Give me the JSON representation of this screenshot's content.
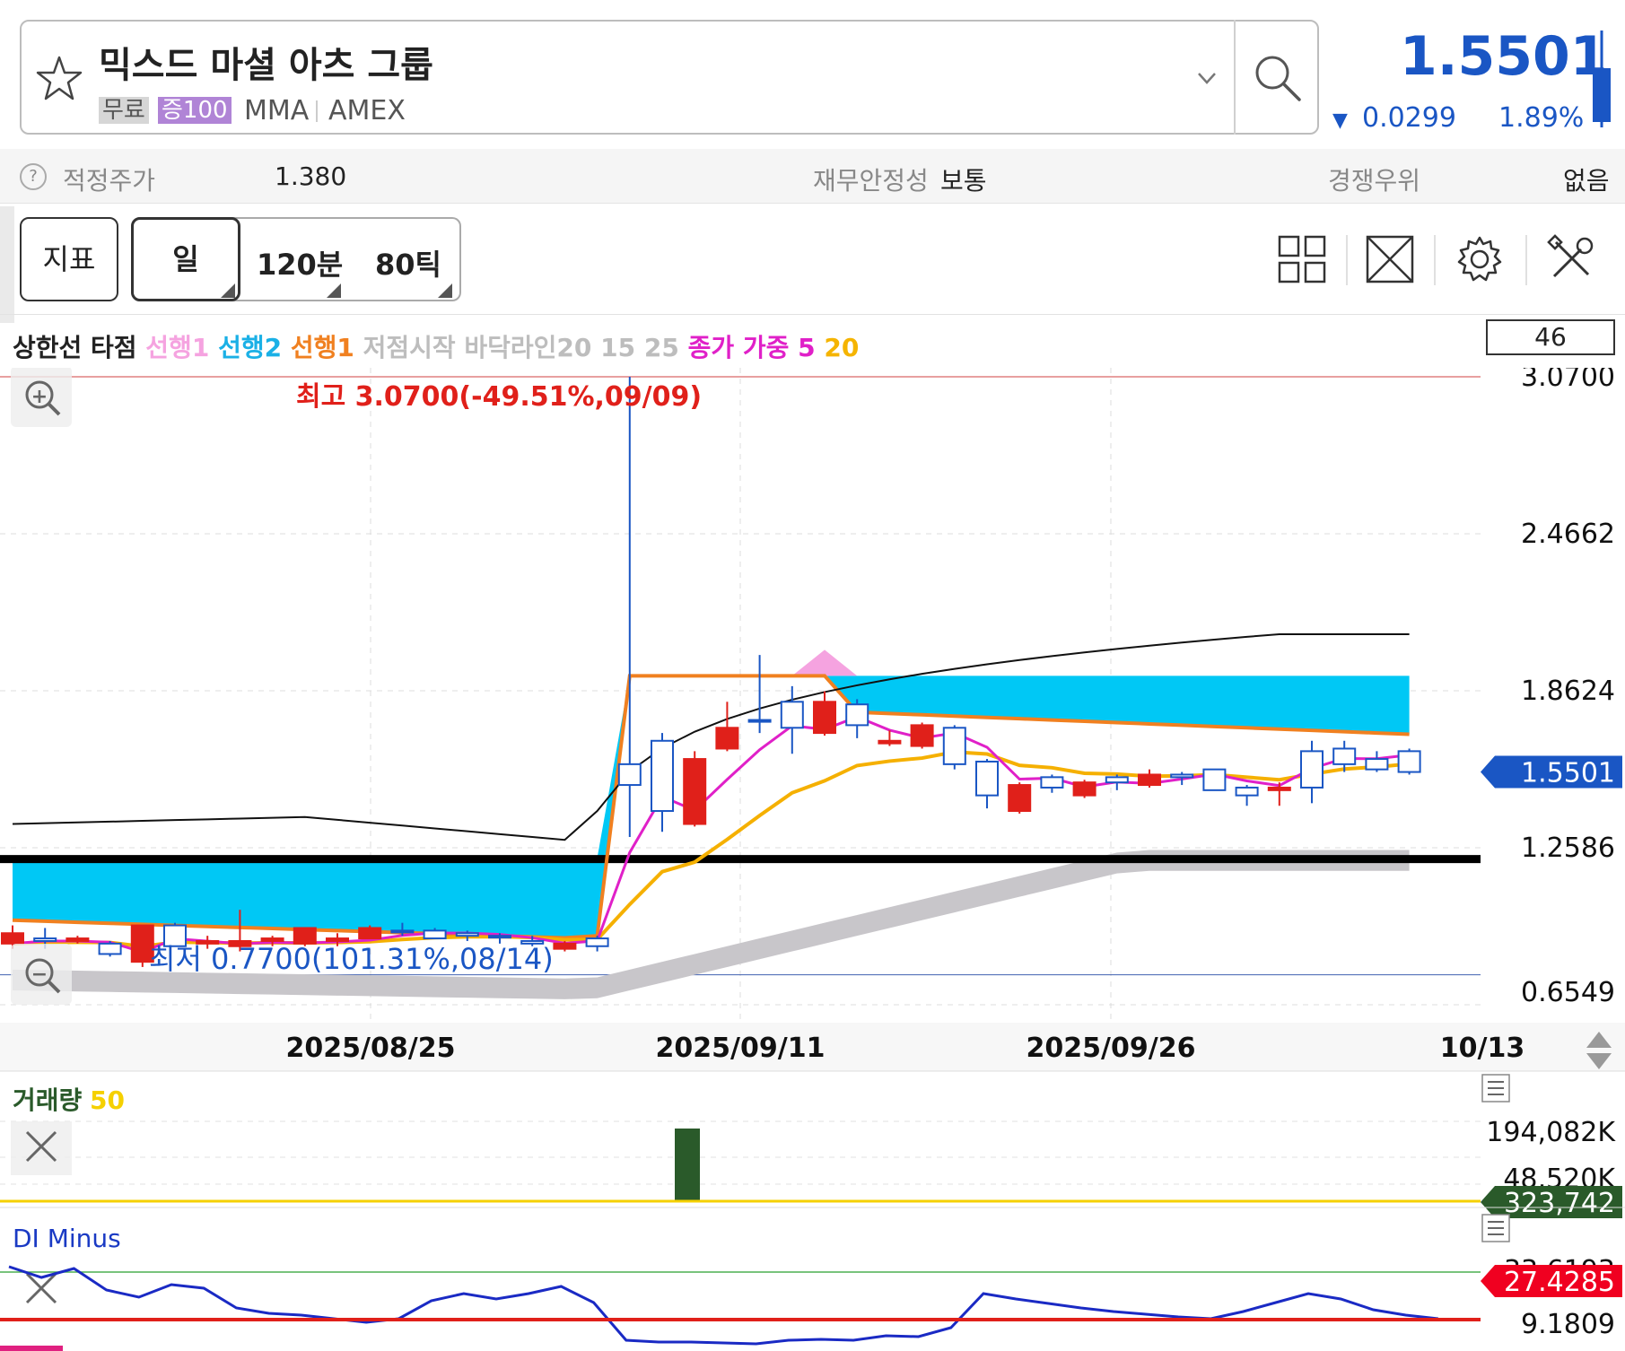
{
  "header": {
    "stock_name": "믹스드 마셜 아츠 그룹",
    "tag_free": "무료",
    "tag_margin": "증100",
    "ticker": "MMA",
    "exchange": "AMEX",
    "price": "1.5501",
    "change_arrow": "▼",
    "change": "0.0299",
    "change_pct": "1.89%",
    "price_color": "#1a56c4"
  },
  "info_bar": {
    "help": "?",
    "fair_price_label": "적정주가",
    "fair_price_value": "1.380",
    "stability_label": "재무안정성",
    "stability_value": "보통",
    "competitive_label": "경쟁우위",
    "competitive_value": "없음"
  },
  "toolbar": {
    "indicator_label": "지표",
    "day_label": "일",
    "min120_label": "120분",
    "tick80_label": "80틱"
  },
  "legend": {
    "items": [
      {
        "text": "상한선 타점 ",
        "color": "#222222"
      },
      {
        "text": "선행1 ",
        "color": "#f5a3e0"
      },
      {
        "text": "선행2 ",
        "color": "#1ab0e6"
      },
      {
        "text": "선행1 ",
        "color": "#f08020"
      },
      {
        "text": "저점시작 바닥라인20 15 25 ",
        "color": "#bdbdbd"
      },
      {
        "text": "종가 가중 5 ",
        "color": "#e020c8"
      },
      {
        "text": "20",
        "color": "#f5b400"
      }
    ],
    "count": "46"
  },
  "chart_data": {
    "type": "candlestick",
    "price_axis": {
      "ticks": [
        "3.0700",
        "2.4662",
        "1.8624",
        "1.2586",
        "0.6549"
      ],
      "min": 0.6549,
      "max": 3.07,
      "current": "1.5501"
    },
    "date_axis": {
      "ticks": [
        "2025/08/25",
        "2025/09/11",
        "2025/09/26",
        "10/13"
      ]
    },
    "high_annotation": "최고 3.0700(-49.51%,09/09)",
    "low_annotation": "최저 0.7700(101.31%,08/14)",
    "candles": [
      {
        "o": 0.93,
        "h": 0.96,
        "l": 0.87,
        "c": 0.89
      },
      {
        "o": 0.9,
        "h": 0.95,
        "l": 0.87,
        "c": 0.91
      },
      {
        "o": 0.91,
        "h": 0.92,
        "l": 0.89,
        "c": 0.9
      },
      {
        "o": 0.85,
        "h": 0.9,
        "l": 0.84,
        "c": 0.89
      },
      {
        "o": 0.96,
        "h": 0.96,
        "l": 0.8,
        "c": 0.82
      },
      {
        "o": 0.88,
        "h": 0.97,
        "l": 0.88,
        "c": 0.96
      },
      {
        "o": 0.9,
        "h": 0.92,
        "l": 0.87,
        "c": 0.89
      },
      {
        "o": 0.9,
        "h": 1.02,
        "l": 0.86,
        "c": 0.88
      },
      {
        "o": 0.91,
        "h": 0.92,
        "l": 0.88,
        "c": 0.9
      },
      {
        "o": 0.95,
        "h": 0.95,
        "l": 0.88,
        "c": 0.89
      },
      {
        "o": 0.91,
        "h": 0.93,
        "l": 0.88,
        "c": 0.9
      },
      {
        "o": 0.95,
        "h": 0.96,
        "l": 0.91,
        "c": 0.91
      },
      {
        "o": 0.94,
        "h": 0.97,
        "l": 0.92,
        "c": 0.94
      },
      {
        "o": 0.91,
        "h": 0.95,
        "l": 0.91,
        "c": 0.94
      },
      {
        "o": 0.92,
        "h": 0.94,
        "l": 0.9,
        "c": 0.93
      },
      {
        "o": 0.92,
        "h": 0.93,
        "l": 0.89,
        "c": 0.92
      },
      {
        "o": 0.89,
        "h": 0.92,
        "l": 0.88,
        "c": 0.9
      },
      {
        "o": 0.89,
        "h": 0.9,
        "l": 0.86,
        "c": 0.87
      },
      {
        "o": 0.88,
        "h": 0.92,
        "l": 0.86,
        "c": 0.91
      },
      {
        "o": 1.5,
        "h": 3.07,
        "l": 1.3,
        "c": 1.58
      },
      {
        "o": 1.4,
        "h": 1.7,
        "l": 1.32,
        "c": 1.67
      },
      {
        "o": 1.6,
        "h": 1.63,
        "l": 1.34,
        "c": 1.35
      },
      {
        "o": 1.72,
        "h": 1.82,
        "l": 1.63,
        "c": 1.64
      },
      {
        "o": 1.75,
        "h": 2.0,
        "l": 1.7,
        "c": 1.75
      },
      {
        "o": 1.72,
        "h": 1.88,
        "l": 1.62,
        "c": 1.82
      },
      {
        "o": 1.82,
        "h": 1.86,
        "l": 1.69,
        "c": 1.7
      },
      {
        "o": 1.73,
        "h": 1.83,
        "l": 1.68,
        "c": 1.81
      },
      {
        "o": 1.67,
        "h": 1.71,
        "l": 1.65,
        "c": 1.66
      },
      {
        "o": 1.73,
        "h": 1.74,
        "l": 1.64,
        "c": 1.65
      },
      {
        "o": 1.58,
        "h": 1.73,
        "l": 1.56,
        "c": 1.72
      },
      {
        "o": 1.46,
        "h": 1.6,
        "l": 1.41,
        "c": 1.59
      },
      {
        "o": 1.5,
        "h": 1.51,
        "l": 1.39,
        "c": 1.4
      },
      {
        "o": 1.49,
        "h": 1.54,
        "l": 1.47,
        "c": 1.53
      },
      {
        "o": 1.51,
        "h": 1.52,
        "l": 1.45,
        "c": 1.46
      },
      {
        "o": 1.51,
        "h": 1.54,
        "l": 1.48,
        "c": 1.53
      },
      {
        "o": 1.54,
        "h": 1.56,
        "l": 1.49,
        "c": 1.5
      },
      {
        "o": 1.53,
        "h": 1.55,
        "l": 1.5,
        "c": 1.54
      },
      {
        "o": 1.48,
        "h": 1.56,
        "l": 1.48,
        "c": 1.56
      },
      {
        "o": 1.46,
        "h": 1.5,
        "l": 1.42,
        "c": 1.49
      },
      {
        "o": 1.49,
        "h": 1.51,
        "l": 1.42,
        "c": 1.48
      },
      {
        "o": 1.49,
        "h": 1.67,
        "l": 1.43,
        "c": 1.63
      },
      {
        "o": 1.58,
        "h": 1.67,
        "l": 1.55,
        "c": 1.64
      },
      {
        "o": 1.56,
        "h": 1.63,
        "l": 1.55,
        "c": 1.6
      },
      {
        "o": 1.55,
        "h": 1.64,
        "l": 1.54,
        "c": 1.63
      }
    ],
    "volume_panel": {
      "label": "거래량",
      "ma_label": "50",
      "axis_ticks": [
        "194,082K",
        "48,520K"
      ],
      "current": "323,742"
    },
    "di_panel": {
      "label": "DI Minus",
      "axis_ticks": [
        "33.6193",
        "9.1809"
      ],
      "current": "27.4285"
    }
  }
}
